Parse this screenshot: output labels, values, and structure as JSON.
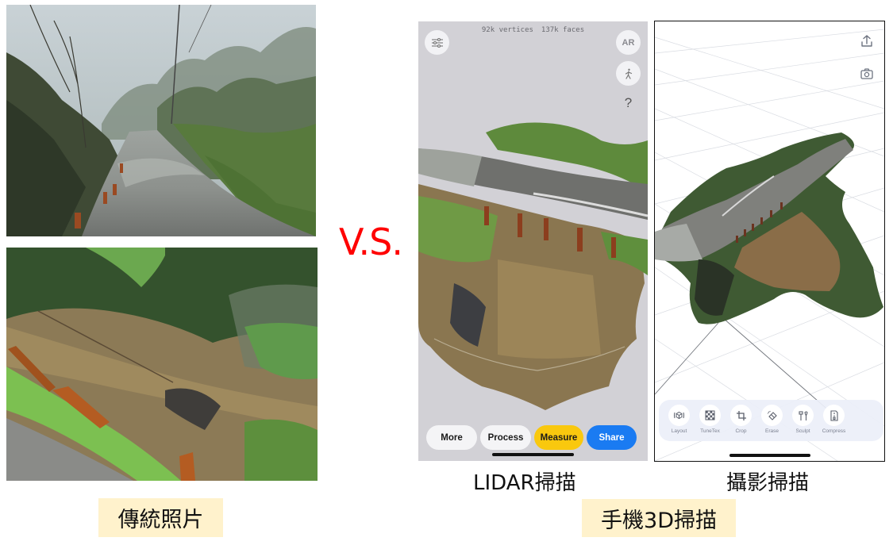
{
  "comparison": {
    "separator": "V.S.",
    "left_caption": "傳統照片",
    "right_caption": "手機3D掃描",
    "lidar_caption": "LIDAR掃描",
    "photogrammetry_caption": "攝影掃描"
  },
  "photos": [
    {
      "subject": "misty-mountain-road-with-collapsed-edge"
    },
    {
      "subject": "landslide-slope-beside-road-with-steel-posts"
    }
  ],
  "lidar_app": {
    "stats": {
      "vertices": "92k vertices",
      "faces": "137k faces"
    },
    "icons": {
      "settings": "sliders-icon",
      "ar_label": "AR",
      "walk": "walking-person-icon",
      "help": "?"
    },
    "buttons": [
      {
        "id": "more",
        "label": "More"
      },
      {
        "id": "process",
        "label": "Process"
      },
      {
        "id": "measure",
        "label": "Measure"
      },
      {
        "id": "share",
        "label": "Share"
      }
    ],
    "colors": {
      "background": "#d2d1d6",
      "measure": "#f9c80e",
      "share": "#1a7bf2"
    }
  },
  "photogrammetry_app": {
    "icons": {
      "share": "upload-icon",
      "camera": "camera-icon"
    },
    "tools": [
      {
        "id": "layout",
        "label": "Layout"
      },
      {
        "id": "tunetex",
        "label": "TuneTex"
      },
      {
        "id": "crop",
        "label": "Crop"
      },
      {
        "id": "erase",
        "label": "Erase"
      },
      {
        "id": "sculpt",
        "label": "Sculpt"
      },
      {
        "id": "compress",
        "label": "Compress"
      }
    ]
  },
  "colors": {
    "caption_bg": "#fff2cc",
    "vs": "#ff0000"
  }
}
